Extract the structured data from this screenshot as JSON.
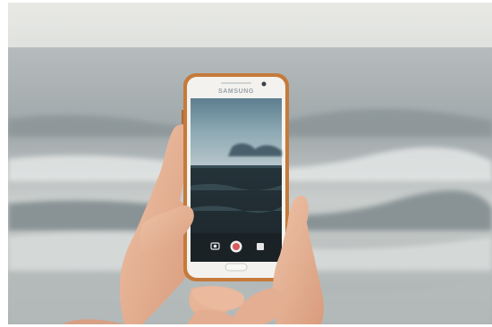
{
  "photo": {
    "subject": "smartphone-photographing-sea",
    "phone_brand": "SAMSUNG",
    "camera_controls": [
      "camera-icon",
      "shutter-button",
      "video-icon"
    ],
    "colors": {
      "sky": "#e3e5e2",
      "sea": "#9aa3a6",
      "phone_case": "#c77b3b",
      "phone_body": "#f4f3ef",
      "skin": "#e9b79b",
      "screen_sky": "#6d8d9d",
      "screen_sea": "#26343a"
    }
  }
}
